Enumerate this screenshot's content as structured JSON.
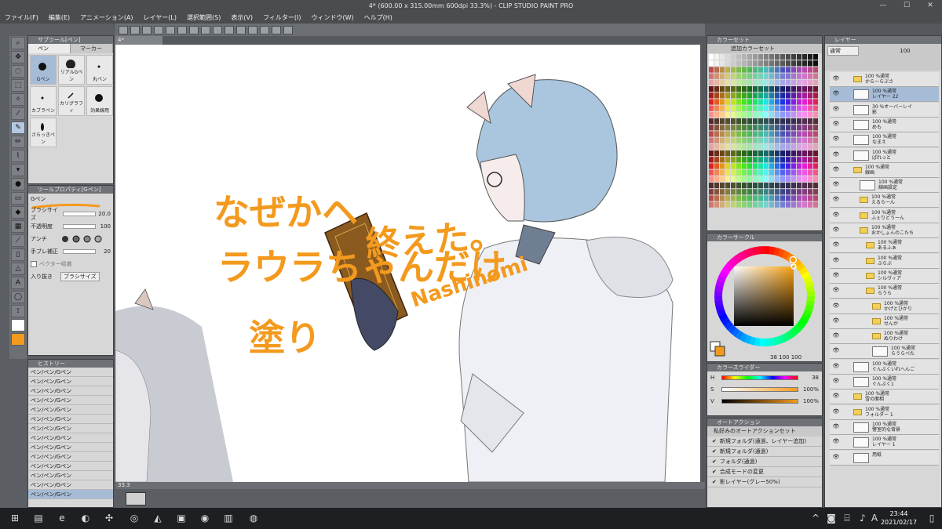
{
  "window": {
    "title": "4* (600.00 x 315.00mm 600dpi 33.3%) - CLIP STUDIO PAINT PRO",
    "minimize": "—",
    "maximize": "☐",
    "close": "✕"
  },
  "menu": [
    "ファイル(F)",
    "編集(E)",
    "アニメーション(A)",
    "レイヤー(L)",
    "選択範囲(S)",
    "表示(V)",
    "フィルター(I)",
    "ウィンドウ(W)",
    "ヘルプ(H)"
  ],
  "doc_tab": "4*",
  "subtool": {
    "title": "サブツール[ペン]",
    "tabs": [
      "ペン",
      "マーカー"
    ],
    "brushes": [
      "Gペン",
      "リアルGペン",
      "丸ペン",
      "カブラペン",
      "カリグラフィ",
      "効果線用",
      "さらっきペン"
    ]
  },
  "toolprop": {
    "title": "ツールプロパティ[Gペン]",
    "brush_name": "Gペン",
    "brush_size_label": "ブラシサイズ",
    "brush_size_value": "20.0",
    "opacity_label": "不透明度",
    "opacity_value": "100",
    "antialias_label": "アンチ",
    "stabilize_label": "手ブレ補正",
    "stabilize_value": "20",
    "vector_label": "ベクター吸着",
    "taper_label": "入り抜き",
    "taper_value": "ブラシサイズ"
  },
  "history": {
    "title": "ヒストリー",
    "items": [
      "ペン/ペン/Gペン",
      "ペン/ペン/Gペン",
      "ペン/ペン/Gペン",
      "ペン/ペン/Gペン",
      "ペン/ペン/Gペン",
      "ペン/ペン/Gペン",
      "ペン/ペン/Gペン",
      "ペン/ペン/Gペン",
      "ペン/ペン/Gペン",
      "ペン/ペン/Gペン",
      "ペン/ペン/Gペン",
      "ペン/ペン/Gペン",
      "ペン/ペン/Gペン",
      "ペン/ペン/Gペン"
    ]
  },
  "canvas_text": {
    "line1": "なぜかヘ",
    "line2": "ラウラちゃんだけ",
    "line3": "塗り",
    "line4": "終えた。",
    "signature": "Nashinomi"
  },
  "canvas_status": "33.3",
  "colorset": {
    "title": "カラーセット",
    "set_name": "追加カラーセット"
  },
  "colorcircle": {
    "title": "カラーサークル",
    "hue_deg": 38,
    "readout": "38 100 100"
  },
  "colorslider": {
    "title": "カラースライダー",
    "rows": [
      {
        "label": "H",
        "value": "38"
      },
      {
        "label": "S",
        "value": "100%"
      },
      {
        "label": "V",
        "value": "100%"
      }
    ]
  },
  "autoaction": {
    "title": "オートアクション",
    "set_name": "私好みのオートアクションセット",
    "items": [
      "新規フォルダ(通過、レイヤー追加)",
      "新規フォルダ(通過)",
      "フォルダ(通過)",
      "合成モードの変更",
      "影レイヤー(グレー50%)"
    ]
  },
  "layer": {
    "title": "レイヤー",
    "blend_mode": "通常",
    "opacity": "100",
    "rows": [
      {
        "kind": "folder",
        "indent": 0,
        "top": "100 %通常",
        "name": "からーらぶさ",
        "sel": false
      },
      {
        "kind": "thumb",
        "indent": 0,
        "top": "100 %通常",
        "name": "レイヤー 22",
        "sel": true
      },
      {
        "kind": "thumb",
        "indent": 0,
        "top": "30 %オーバーレイ",
        "name": "影",
        "sel": false
      },
      {
        "kind": "thumb",
        "indent": 0,
        "top": "100 %通常",
        "name": "めも",
        "sel": false
      },
      {
        "kind": "thumb",
        "indent": 0,
        "top": "100 %通常",
        "name": "なまえ",
        "sel": false
      },
      {
        "kind": "thumb",
        "indent": 0,
        "top": "100 %通常",
        "name": "ぱれっと",
        "sel": false
      },
      {
        "kind": "folder",
        "indent": 0,
        "top": "100 %通常",
        "name": "線画",
        "sel": false
      },
      {
        "kind": "thumb",
        "indent": 1,
        "top": "100 %通常",
        "name": "線画設定",
        "sel": false
      },
      {
        "kind": "folder",
        "indent": 1,
        "top": "100 %通常",
        "name": "えるらーん",
        "sel": false
      },
      {
        "kind": "folder",
        "indent": 1,
        "top": "100 %通常",
        "name": "ふぇりどうーん",
        "sel": false
      },
      {
        "kind": "folder",
        "indent": 1,
        "top": "100 %通常",
        "name": "おかしょんのこたち",
        "sel": false
      },
      {
        "kind": "folder",
        "indent": 2,
        "top": "100 %通常",
        "name": "あるふぁ",
        "sel": false
      },
      {
        "kind": "folder",
        "indent": 2,
        "top": "100 %通常",
        "name": "ぶらぶ",
        "sel": false
      },
      {
        "kind": "folder",
        "indent": 2,
        "top": "100 %通常",
        "name": "シルヴィア",
        "sel": false
      },
      {
        "kind": "folder",
        "indent": 2,
        "top": "100 %通常",
        "name": "らうら",
        "sel": false
      },
      {
        "kind": "folder",
        "indent": 3,
        "top": "100 %通常",
        "name": "かげとひかり",
        "sel": false
      },
      {
        "kind": "folder",
        "indent": 3,
        "top": "100 %通常",
        "name": "せんが",
        "sel": false
      },
      {
        "kind": "folder",
        "indent": 3,
        "top": "100 %通常",
        "name": "ぬりわけ",
        "sel": false
      },
      {
        "kind": "thumb",
        "indent": 3,
        "top": "100 %通常",
        "name": "らうらべた",
        "sel": false
      },
      {
        "kind": "thumb",
        "indent": 0,
        "top": "100 %通常",
        "name": "ぐんぶくいれへんご",
        "sel": false
      },
      {
        "kind": "thumb",
        "indent": 0,
        "top": "100 %通常",
        "name": "ぐんぶく1",
        "sel": false
      },
      {
        "kind": "folder",
        "indent": 0,
        "top": "100 %通常",
        "name": "雪の面相",
        "sel": false
      },
      {
        "kind": "folder",
        "indent": 0,
        "top": "100 %通常",
        "name": "フォルダー 1",
        "sel": false
      },
      {
        "kind": "thumb",
        "indent": 0,
        "top": "100 %通常",
        "name": "警室的な背景",
        "sel": false
      },
      {
        "kind": "thumb",
        "indent": 0,
        "top": "100 %通常",
        "name": "レイヤー 1",
        "sel": false
      },
      {
        "kind": "thumb",
        "indent": 0,
        "top": "",
        "name": "用紙",
        "sel": false
      }
    ]
  },
  "clock": {
    "time": "23:44",
    "date": "2021/02/17"
  },
  "colors": {
    "accent_orange": "#f39a1e",
    "selection_blue": "#a6bcd6",
    "panel_dark": "#4a4c4f"
  }
}
